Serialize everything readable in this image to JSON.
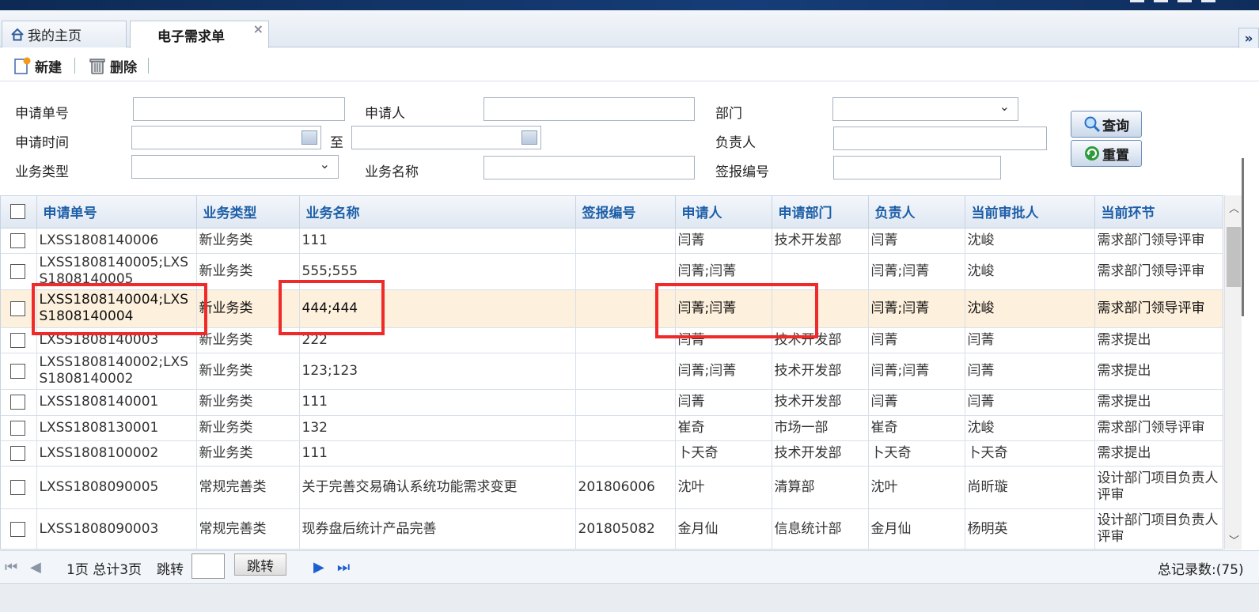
{
  "tabs": [
    {
      "label": "我的主页"
    },
    {
      "label": "电子需求单"
    }
  ],
  "toolbar": {
    "new_label": "新建",
    "delete_label": "删除"
  },
  "filters": {
    "req_no": "申请单号",
    "applicant": "申请人",
    "dept": "部门",
    "req_time": "申请时间",
    "to": "至",
    "owner": "负责人",
    "biz_type": "业务类型",
    "biz_name": "业务名称",
    "sign_no": "签报编号",
    "query_label": "查询",
    "reset_label": "重置"
  },
  "table": {
    "headers": [
      "申请单号",
      "业务类型",
      "业务名称",
      "签报编号",
      "申请人",
      "申请部门",
      "负责人",
      "当前审批人",
      "当前环节"
    ],
    "rows": [
      [
        "LXSS1808140006",
        "新业务类",
        "111",
        "",
        "闫菁",
        "技术开发部",
        "闫菁",
        "沈峻",
        "需求部门领导评审"
      ],
      [
        "LXSS1808140005;LXSS1808140005",
        "新业务类",
        "555;555",
        "",
        "闫菁;闫菁",
        "",
        "闫菁;闫菁",
        "沈峻",
        "需求部门领导评审"
      ],
      [
        "LXSS1808140004;LXSS1808140004",
        "新业务类",
        "444;444",
        "",
        "闫菁;闫菁",
        "",
        "闫菁;闫菁",
        "沈峻",
        "需求部门领导评审"
      ],
      [
        "LXSS1808140003",
        "新业务类",
        "222",
        "",
        "闫菁",
        "技术开发部",
        "闫菁",
        "闫菁",
        "需求提出"
      ],
      [
        "LXSS1808140002;LXSS1808140002",
        "新业务类",
        "123;123",
        "",
        "闫菁;闫菁",
        "技术开发部",
        "闫菁;闫菁",
        "闫菁",
        "需求提出"
      ],
      [
        "LXSS1808140001",
        "新业务类",
        "111",
        "",
        "闫菁",
        "技术开发部",
        "闫菁",
        "闫菁",
        "需求提出"
      ],
      [
        "LXSS1808130001",
        "新业务类",
        "132",
        "",
        "崔奇",
        "市场一部",
        "崔奇",
        "沈峻",
        "需求部门领导评审"
      ],
      [
        "LXSS1808100002",
        "新业务类",
        "111",
        "",
        "卜天奇",
        "技术开发部",
        "卜天奇",
        "卜天奇",
        "需求提出"
      ],
      [
        "LXSS1808090005",
        "常规完善类",
        "关于完善交易确认系统功能需求变更",
        "201806006",
        "沈叶",
        "清算部",
        "沈叶",
        "尚昕璇",
        "设计部门项目负责人评审"
      ],
      [
        "LXSS1808090003",
        "常规完善类",
        "现券盘后统计产品完善",
        "201805082",
        "金月仙",
        "信息统计部",
        "金月仙",
        "杨明英",
        "设计部门项目负责人评审"
      ]
    ]
  },
  "pager": {
    "page_info": "1页 总计3页",
    "jump_label": "跳转",
    "jump_button": "跳转",
    "total": "总记录数:(75)"
  },
  "colors": {
    "accent": "#1e5fa8",
    "highlight": "#ee2a2a",
    "selected_row": "#fdf0dc"
  }
}
